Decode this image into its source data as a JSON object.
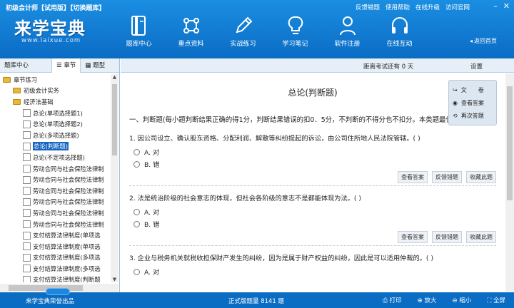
{
  "header": {
    "app_title": "初级会计师【试用版】【切换题库】",
    "top_links": [
      "反馈错题",
      "使用帮助",
      "在线升级",
      "访问官网"
    ],
    "logo": "来学宝典",
    "logo_url": "www.laixue.com",
    "nav": [
      {
        "label": "题库中心",
        "icon": "book-icon"
      },
      {
        "label": "重点资料",
        "icon": "network-icon"
      },
      {
        "label": "实战练习",
        "icon": "pencil-icon"
      },
      {
        "label": "学习笔记",
        "icon": "lightbulb-icon"
      },
      {
        "label": "软件注册",
        "icon": "user-icon"
      },
      {
        "label": "在线互动",
        "icon": "headset-icon"
      }
    ],
    "home_label": "返回首页"
  },
  "left": {
    "tabs": [
      "题库中心",
      "章节",
      "题型"
    ],
    "tree": [
      {
        "label": "章节练习",
        "level": 0,
        "type": "folder"
      },
      {
        "label": "初级会计实务",
        "level": 1,
        "type": "folder"
      },
      {
        "label": "经济法基础",
        "level": 1,
        "type": "folder"
      },
      {
        "label": "总论(单项选择题1)",
        "level": 2,
        "type": "item"
      },
      {
        "label": "总论(单项选择题2)",
        "level": 2,
        "type": "item"
      },
      {
        "label": "总论(多项选择题)",
        "level": 2,
        "type": "item"
      },
      {
        "label": "总论(判断题)",
        "level": 2,
        "type": "item",
        "selected": true
      },
      {
        "label": "总论(不定项选择题)",
        "level": 2,
        "type": "item"
      },
      {
        "label": "劳动合同与社会保险法律制",
        "level": 2,
        "type": "item"
      },
      {
        "label": "劳动合同与社会保险法律制",
        "level": 2,
        "type": "item"
      },
      {
        "label": "劳动合同与社会保险法律制",
        "level": 2,
        "type": "item"
      },
      {
        "label": "劳动合同与社会保险法律制",
        "level": 2,
        "type": "item"
      },
      {
        "label": "劳动合同与社会保险法律制",
        "level": 2,
        "type": "item"
      },
      {
        "label": "劳动合同与社会保险法律制",
        "level": 2,
        "type": "item"
      },
      {
        "label": "支付结算法律制度(单项选",
        "level": 2,
        "type": "item"
      },
      {
        "label": "支付结算法律制度(单项选",
        "level": 2,
        "type": "item"
      },
      {
        "label": "支付结算法律制度(多项选",
        "level": 2,
        "type": "item"
      },
      {
        "label": "支付结算法律制度(多项选",
        "level": 2,
        "type": "item"
      },
      {
        "label": "支付结算法律制度(判断题",
        "level": 2,
        "type": "item"
      }
    ]
  },
  "main": {
    "countdown": "距离考试还有 0 天",
    "settings_label": "设置",
    "page_title": "总论(判断题)",
    "intro": "一、判断题(每小题判断结果正确的得1分，判断结果错误的扣0．5分，不判断的不得分也不扣分。本类题最低得分为零分)",
    "questions": [
      {
        "text": "1. 因公司设立、确认股东资格、分配利润、解散等纠纷提起的诉讼，由公司住所地人民法院管辖。( )",
        "options": [
          "A. 对",
          "B. 错"
        ]
      },
      {
        "text": "2. 法是统治阶级的社会意志的体现，但社会各阶级的意志不是都能体现为法。( )",
        "options": [
          "A. 对",
          "B. 错"
        ]
      },
      {
        "text": "3. 企业与税务机关就税收担保财产发生的纠纷，因为是属于财产权益的纠纷，因此是可以适用仲裁的。( )",
        "options": [
          "A. 对"
        ]
      }
    ],
    "question_buttons": [
      "查看答案",
      "反馈错题",
      "收藏此题"
    ]
  },
  "float_panel": {
    "items": [
      "文　　卷",
      "查看答案",
      "再次答题"
    ]
  },
  "footer": {
    "product": "来学宝典荣誉出品",
    "total": "正式版题量 8141 题",
    "actions": [
      "打印",
      "放大",
      "缩小",
      "全屏"
    ]
  }
}
